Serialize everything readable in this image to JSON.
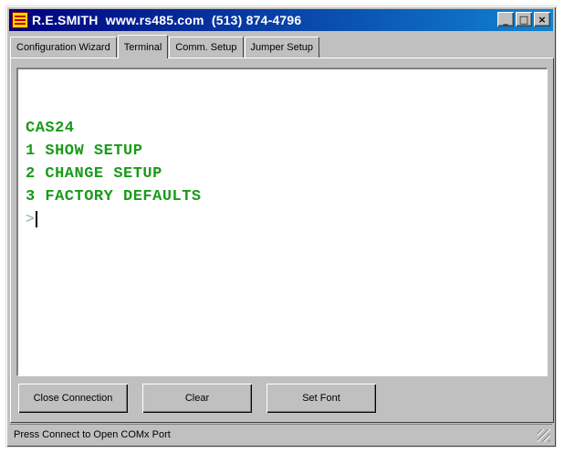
{
  "window": {
    "title": "R.E.SMITH  www.rs485.com  (513) 874-4796",
    "controls": {
      "minimize": "_",
      "maximize": "□",
      "close": "×"
    }
  },
  "tabs": [
    {
      "label": "Configuration Wizard",
      "active": false
    },
    {
      "label": "Terminal",
      "active": true
    },
    {
      "label": "Comm. Setup",
      "active": false
    },
    {
      "label": "Jumper Setup",
      "active": false
    }
  ],
  "terminal": {
    "lines": [
      "CAS24",
      "1 SHOW SETUP",
      "2 CHANGE SETUP",
      "3 FACTORY DEFAULTS"
    ],
    "prompt": ">",
    "text_color": "#1a9a1a"
  },
  "buttons": {
    "close_connection": "Close Connection",
    "clear": "Clear",
    "set_font": "Set Font"
  },
  "status": {
    "text": "Press Connect to Open COMx Port"
  }
}
